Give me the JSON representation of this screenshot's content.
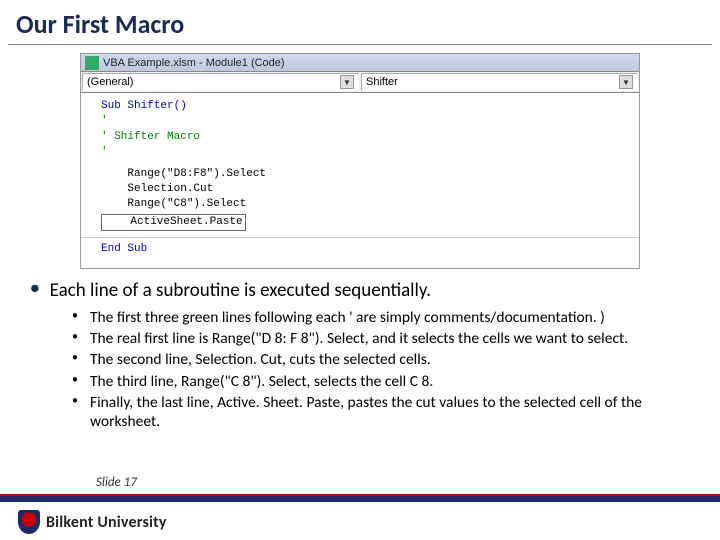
{
  "title": "Our First Macro",
  "codeWindow": {
    "titlebar": "VBA Example.xlsm - Module1 (Code)",
    "ddLeft": "(General)",
    "ddRight": "Shifter",
    "lines": {
      "l0": "Sub Shifter()",
      "l1": "'",
      "l2": "' Shifter Macro",
      "l3": "'",
      "l4": "    Range(\"D8:F8\").Select",
      "l5": "    Selection.Cut",
      "l6": "    Range(\"C8\").Select",
      "l7": "    ActiveSheet.Paste",
      "l8": "End Sub"
    }
  },
  "mainBullet": "Each line of a subroutine is executed sequentially.",
  "subBullets": [
    "The first three green lines following each ' are  simply comments/documentation. )",
    "The real first line is Range(\"D 8: F 8\"). Select, and it selects the cells we want to select.",
    "The second line, Selection. Cut, cuts the selected cells.",
    "The third line, Range(\"C 8\"). Select, selects the cell C 8.",
    "Finally, the last line, Active. Sheet. Paste, pastes the cut values to the selected cell of the worksheet."
  ],
  "slideNum": "Slide 17",
  "university": "Bilkent University"
}
